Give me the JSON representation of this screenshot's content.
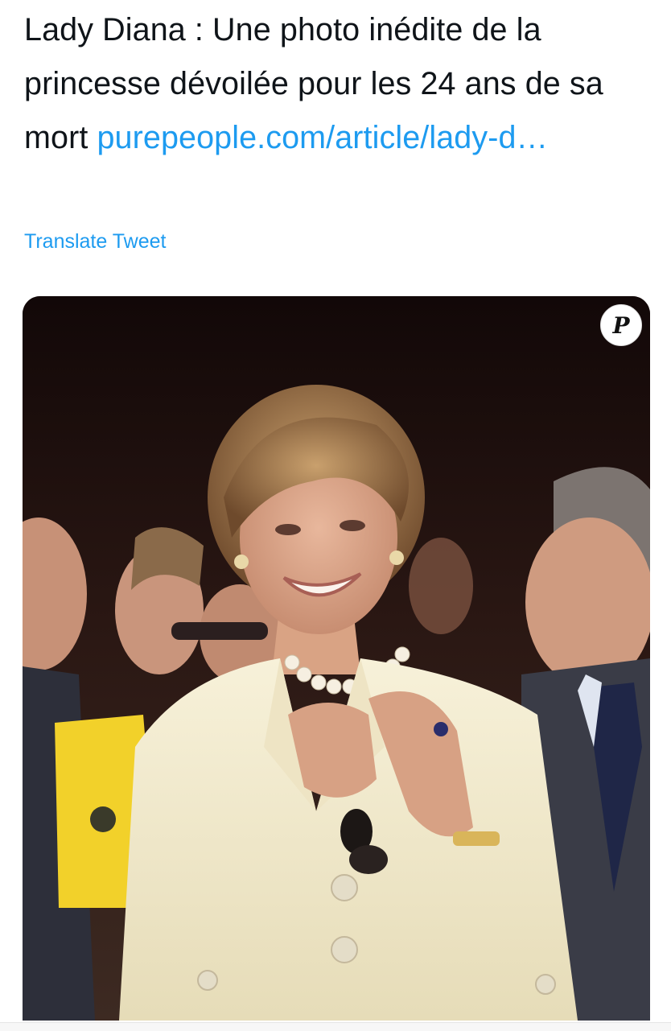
{
  "tweet": {
    "text": "Lady Diana : Une photo inédite de la princesse dévoilée pour les 24 ans de sa mort ",
    "link_label": "purepeople.com/article/lady-d…",
    "translate_label": "Translate Tweet"
  },
  "media": {
    "badge_letter": "P"
  },
  "colors": {
    "link": "#1d9bf0",
    "text": "#0f1419",
    "jacket": "#f3eccf",
    "background": "#1a0d0d"
  }
}
